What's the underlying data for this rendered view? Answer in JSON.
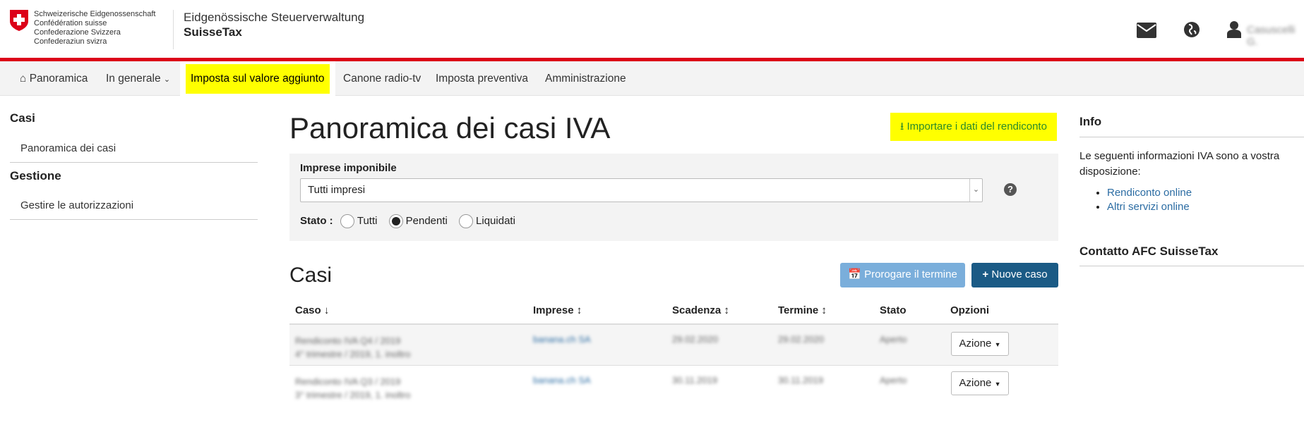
{
  "header": {
    "logo_lines": [
      "Schweizerische Eidgenossenschaft",
      "Confédération suisse",
      "Confederazione Svizzera",
      "Confederaziun svizra"
    ],
    "agency": "Eidgenössische Steuerverwaltung",
    "app": "SuisseTax",
    "user": "Casuscelli G."
  },
  "nav": [
    "Panoramica",
    "In generale",
    "Imposta sul valore aggiunto",
    "Canone radio-tv",
    "Imposta preventiva",
    "Amministrazione"
  ],
  "left": {
    "h1": "Casi",
    "l1": "Panoramica dei casi",
    "h2": "Gestione",
    "l2": "Gestire le autorizzazioni"
  },
  "main": {
    "title": "Panoramica dei casi IVA",
    "import": "Importare i dati del rendiconto",
    "filter_label": "Imprese imponibile",
    "filter_value": "Tutti impresi",
    "stato_label": "Stato :",
    "stato_options": [
      "Tutti",
      "Pendenti",
      "Liquidati"
    ],
    "stato_selected": "Pendenti",
    "cases_title": "Casi",
    "extend": "Prorogare il termine",
    "new_case": "Nuove caso",
    "columns": [
      "Caso",
      "Imprese",
      "Scadenza",
      "Termine",
      "Stato",
      "Opzioni"
    ],
    "rows": [
      {
        "caso": "Rendiconto IVA Q4 / 2019",
        "sub": "4° trimestre / 2019, 1. inoltro",
        "impresa": "banana.ch SA",
        "scadenza": "29.02.2020",
        "termine": "29.02.2020",
        "stato": "Aperto",
        "azione": "Azione"
      },
      {
        "caso": "Rendiconto IVA Q3 / 2019",
        "sub": "3° trimestre / 2019, 1. inoltro",
        "impresa": "banana.ch SA",
        "scadenza": "30.11.2019",
        "termine": "30.11.2019",
        "stato": "Aperto",
        "azione": "Azione"
      }
    ]
  },
  "right": {
    "info": "Info",
    "text": "Le seguenti informazioni IVA sono a vostra disposizione:",
    "links": [
      "Rendiconto online",
      "Altri servizi online"
    ],
    "contact": "Contatto AFC SuisseTax"
  }
}
